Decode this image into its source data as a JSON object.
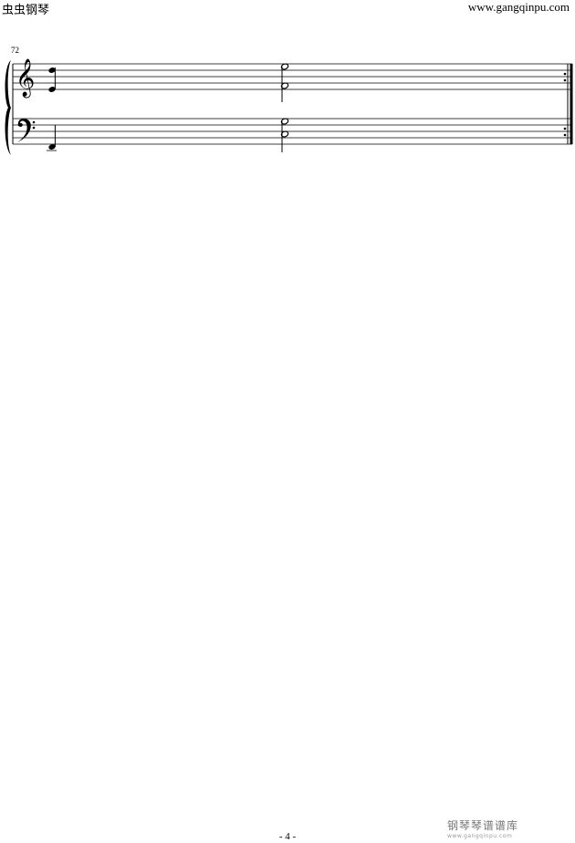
{
  "header": {
    "site_name": "虫虫钢琴",
    "site_url": "www.gangqinpu.com"
  },
  "score": {
    "measure_number": "72",
    "treble_clef": "treble-clef",
    "bass_clef": "bass-clef",
    "ending": "repeat-end-barline"
  },
  "footer": {
    "page_number": "- 4 -"
  },
  "watermark": {
    "title": "钢琴琴谱谱库",
    "subtitle": "www.gangqinpu.com"
  }
}
